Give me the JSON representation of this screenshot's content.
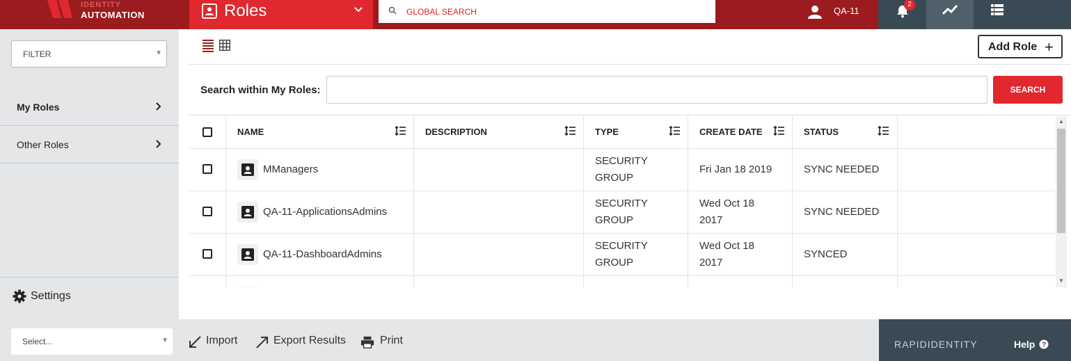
{
  "header": {
    "logo_line1": "IDENTITY",
    "logo_line2": "AUTOMATION",
    "module_title": "Roles",
    "global_search_placeholder": "GLOBAL SEARCH",
    "user_name": "QA-11",
    "notification_count": "2"
  },
  "sidebar": {
    "filter_label": "FILTER",
    "items": [
      {
        "label": "My Roles",
        "active": true
      },
      {
        "label": "Other Roles",
        "active": false
      }
    ],
    "settings_label": "Settings"
  },
  "toolbar": {
    "add_role_label": "Add Role",
    "search_label": "Search within My Roles:",
    "search_button": "SEARCH"
  },
  "table": {
    "columns": [
      "NAME",
      "DESCRIPTION",
      "TYPE",
      "CREATE DATE",
      "STATUS"
    ],
    "rows": [
      {
        "name": "MManagers",
        "description": "",
        "type_line1": "SECURITY",
        "type_line2": "GROUP",
        "date_line1": "Fri Jan 18 2019",
        "date_line2": "",
        "status": "SYNC NEEDED"
      },
      {
        "name": "QA-11-ApplicationsAdmins",
        "description": "",
        "type_line1": "SECURITY",
        "type_line2": "GROUP",
        "date_line1": "Wed Oct 18",
        "date_line2": "2017",
        "status": "SYNC NEEDED"
      },
      {
        "name": "QA-11-DashboardAdmins",
        "description": "",
        "type_line1": "SECURITY",
        "type_line2": "GROUP",
        "date_line1": "Wed Oct 18",
        "date_line2": "2017",
        "status": "SYNCED"
      }
    ]
  },
  "footer": {
    "select_label": "Select...",
    "import_label": "Import",
    "export_label": "Export Results",
    "print_label": "Print",
    "brand": "RAPIDIDENTITY",
    "help_label": "Help"
  },
  "colors": {
    "header_dark_red": "#9b1b1e",
    "accent_red": "#e0282e",
    "slate": "#3a4a55",
    "sidebar_gray": "#e4e6e8"
  },
  "icons": [
    "logo-mark",
    "roles-module-icon",
    "chevron-down-icon",
    "search-icon",
    "user-icon",
    "bell-icon",
    "trend-icon",
    "list-icon",
    "list-view-icon",
    "grid-view-icon",
    "plus-icon",
    "sort-icon",
    "role-avatar-icon",
    "chevron-right-icon",
    "gear-icon",
    "import-icon",
    "export-icon",
    "print-icon",
    "help-icon"
  ]
}
